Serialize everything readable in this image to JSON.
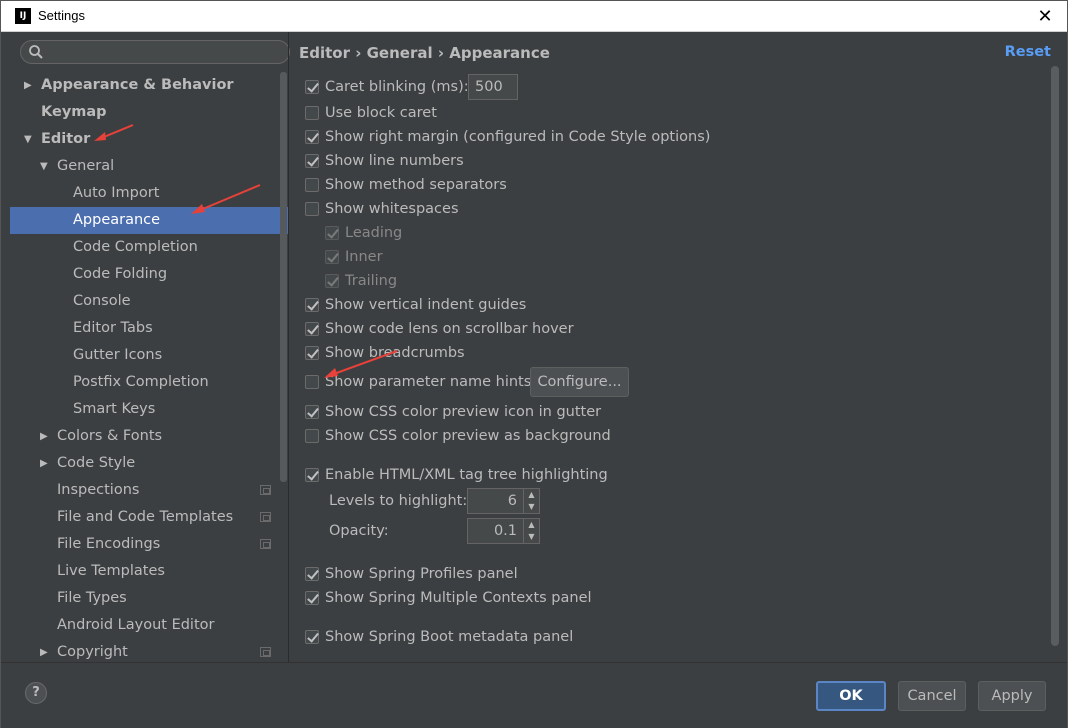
{
  "window": {
    "title": "Settings",
    "icon": "intellij-logo-icon",
    "icon_text": "IJ",
    "close": "✕"
  },
  "search": {
    "placeholder": "",
    "value": ""
  },
  "tree": [
    {
      "label": "Appearance & Behavior",
      "bold": true,
      "arrow": "▶"
    },
    {
      "label": "Keymap",
      "bold": true,
      "arrow": ""
    },
    {
      "label": "Editor",
      "bold": true,
      "arrow": "▼"
    },
    {
      "label": "General",
      "bold": false,
      "arrow": "▼"
    },
    {
      "label": "Auto Import",
      "bold": false,
      "arrow": ""
    },
    {
      "label": "Appearance",
      "bold": false,
      "arrow": "",
      "selected": true
    },
    {
      "label": "Code Completion",
      "bold": false,
      "arrow": ""
    },
    {
      "label": "Code Folding",
      "bold": false,
      "arrow": ""
    },
    {
      "label": "Console",
      "bold": false,
      "arrow": ""
    },
    {
      "label": "Editor Tabs",
      "bold": false,
      "arrow": ""
    },
    {
      "label": "Gutter Icons",
      "bold": false,
      "arrow": ""
    },
    {
      "label": "Postfix Completion",
      "bold": false,
      "arrow": ""
    },
    {
      "label": "Smart Keys",
      "bold": false,
      "arrow": ""
    },
    {
      "label": "Colors & Fonts",
      "bold": false,
      "arrow": "▶"
    },
    {
      "label": "Code Style",
      "bold": false,
      "arrow": "▶"
    },
    {
      "label": "Inspections",
      "bold": false,
      "arrow": "",
      "project_icon": true
    },
    {
      "label": "File and Code Templates",
      "bold": false,
      "arrow": "",
      "project_icon": true
    },
    {
      "label": "File Encodings",
      "bold": false,
      "arrow": "",
      "project_icon": true
    },
    {
      "label": "Live Templates",
      "bold": false,
      "arrow": ""
    },
    {
      "label": "File Types",
      "bold": false,
      "arrow": ""
    },
    {
      "label": "Android Layout Editor",
      "bold": false,
      "arrow": ""
    },
    {
      "label": "Copyright",
      "bold": false,
      "arrow": "▶",
      "project_icon": true
    }
  ],
  "breadcrumb": "Editor › General › Appearance",
  "reset_label": "Reset",
  "options": {
    "caret_blinking": {
      "label": "Caret blinking (ms):",
      "checked": true,
      "value": "500"
    },
    "use_block_caret": {
      "label": "Use block caret",
      "checked": false
    },
    "show_right_margin": {
      "label": "Show right margin (configured in Code Style options)",
      "checked": true
    },
    "show_line_numbers": {
      "label": "Show line numbers",
      "checked": true
    },
    "show_method_separators": {
      "label": "Show method separators",
      "checked": false
    },
    "show_whitespaces": {
      "label": "Show whitespaces",
      "checked": false
    },
    "leading": {
      "label": "Leading",
      "checked": true
    },
    "inner": {
      "label": "Inner",
      "checked": true
    },
    "trailing": {
      "label": "Trailing",
      "checked": true
    },
    "show_vertical_indent_guides": {
      "label": "Show vertical indent guides",
      "checked": true
    },
    "show_code_lens": {
      "label": "Show code lens on scrollbar hover",
      "checked": true
    },
    "show_breadcrumbs": {
      "label": "Show breadcrumbs",
      "checked": true
    },
    "show_parameter_hints": {
      "label": "Show parameter name hints",
      "checked": false,
      "button": "Configure..."
    },
    "show_css_color_icon": {
      "label": "Show CSS color preview icon in gutter",
      "checked": true
    },
    "show_css_color_bg": {
      "label": "Show CSS color preview as background",
      "checked": false
    },
    "enable_tag_tree": {
      "label": "Enable HTML/XML tag tree highlighting",
      "checked": true
    },
    "levels_to_highlight": {
      "label": "Levels to highlight:",
      "value": "6"
    },
    "opacity": {
      "label": "Opacity:",
      "value": "0.1"
    },
    "spring_profiles": {
      "label": "Show Spring Profiles panel",
      "checked": true
    },
    "spring_contexts": {
      "label": "Show Spring Multiple Contexts panel",
      "checked": true
    },
    "spring_boot_metadata": {
      "label": "Show Spring Boot metadata panel",
      "checked": true
    }
  },
  "footer": {
    "help": "?",
    "ok": "OK",
    "cancel": "Cancel",
    "apply": "Apply"
  },
  "colors": {
    "selection": "#4b6eaf",
    "accent_link": "#589df6",
    "annotation_arrow": "#e8413a"
  }
}
